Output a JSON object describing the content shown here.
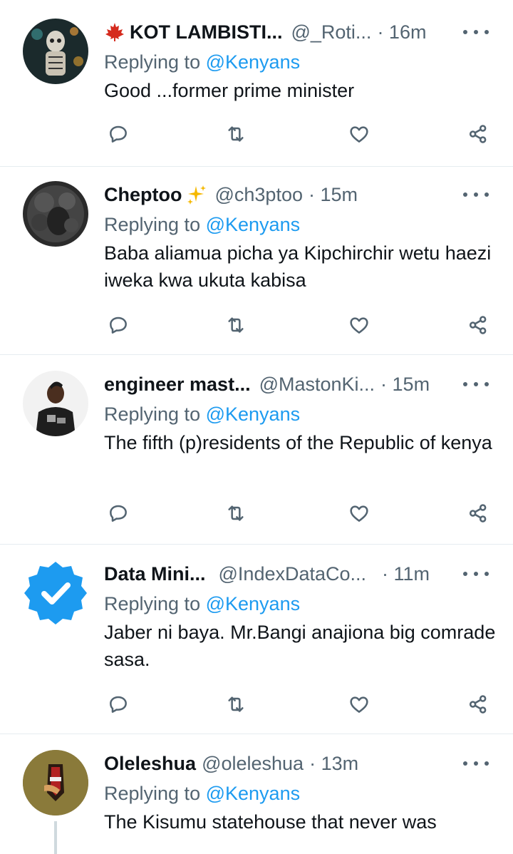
{
  "colors": {
    "accent": "#1d9bf0",
    "muted": "#536471",
    "text": "#0f1419",
    "verified": "#1d9bf0"
  },
  "icons": {
    "reply": "reply-icon",
    "retweet": "retweet-icon",
    "like": "heart-icon",
    "share": "share-icon",
    "more": "more-icon"
  },
  "tweets": [
    {
      "name": "KOT LAMBISTI...",
      "handle": "@_Roti...",
      "time": "· 16m",
      "reply_prefix": "Replying to",
      "reply_handle": "@Kenyans",
      "text": "Good ...former prime minister"
    },
    {
      "name": "Cheptoo",
      "handle": "@ch3ptoo",
      "time": "· 15m",
      "reply_prefix": "Replying to",
      "reply_handle": "@Kenyans",
      "text": "Baba aliamua picha ya Kipchirchir wetu haezi iweka kwa ukuta kabisa"
    },
    {
      "name": "engineer mast...",
      "handle": "@MastonKi...",
      "time": "· 15m",
      "reply_prefix": "Replying to",
      "reply_handle": "@Kenyans",
      "text": "The fifth (p)residents of the Republic of kenya"
    },
    {
      "name": "Data Mini...",
      "handle": "@IndexDataCo...",
      "time": "· 11m",
      "reply_prefix": "Replying to",
      "reply_handle": "@Kenyans",
      "text": "Jaber ni baya. Mr.Bangi anajiona big comrade sasa."
    },
    {
      "name": "Oleleshua",
      "handle": "@oleleshua",
      "time": "· 13m",
      "reply_prefix": "Replying to",
      "reply_handle": "@Kenyans",
      "text": "The Kisumu statehouse that never was"
    }
  ]
}
